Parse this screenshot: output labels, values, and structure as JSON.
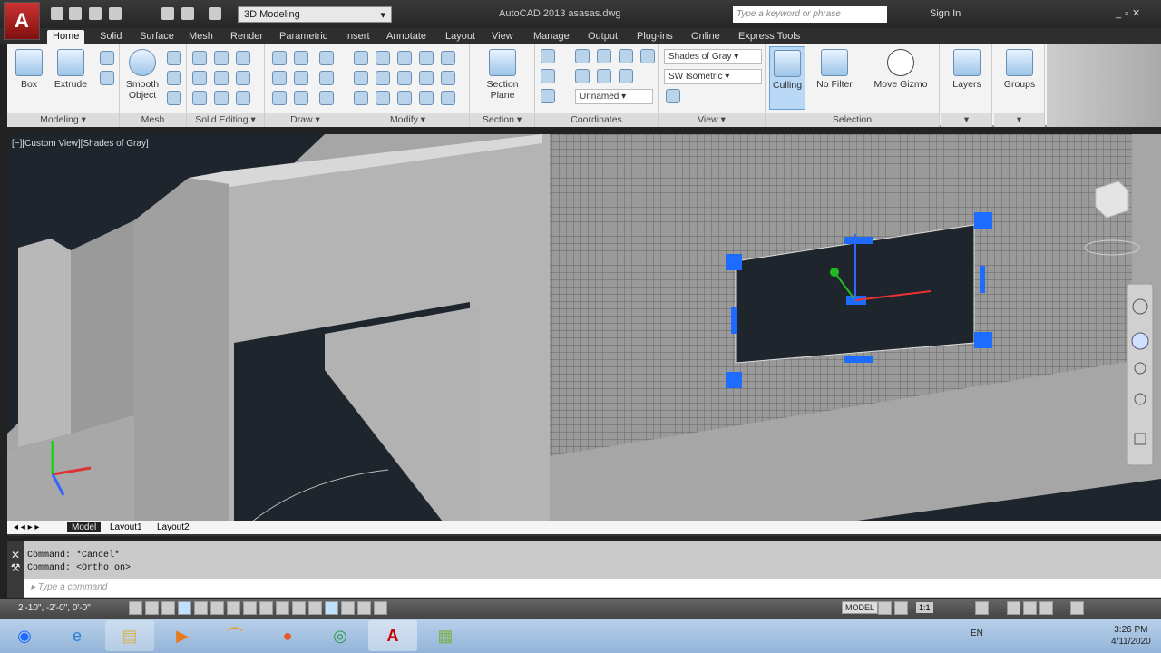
{
  "titlebar": {
    "workspace": "3D Modeling",
    "title": "AutoCAD 2013   asasas.dwg",
    "search_placeholder": "Type a keyword or phrase",
    "signin": "Sign In",
    "app_button": "A"
  },
  "tabs": [
    "Home",
    "Solid",
    "Surface",
    "Mesh",
    "Render",
    "Parametric",
    "Insert",
    "Annotate",
    "Layout",
    "View",
    "Manage",
    "Output",
    "Plug-ins",
    "Online",
    "Express Tools"
  ],
  "ribbon": {
    "modeling": {
      "box": "Box",
      "extrude": "Extrude",
      "label": "Modeling ▾"
    },
    "mesh": {
      "smooth1": "Smooth",
      "smooth2": "Object",
      "label": "Mesh"
    },
    "solid_editing": {
      "label": "Solid Editing ▾"
    },
    "draw": {
      "label": "Draw ▾"
    },
    "modify": {
      "label": "Modify ▾"
    },
    "section": {
      "plane1": "Section",
      "plane2": "Plane",
      "label": "Section ▾"
    },
    "coordinates": {
      "ucs": "Unnamed",
      "label": "Coordinates"
    },
    "view": {
      "visual_style": "Shades of Gray",
      "view_dir": "SW Isometric",
      "label": "View ▾"
    },
    "selection": {
      "culling": "Culling",
      "nofilter": "No Filter",
      "gizmo": "Move Gizmo",
      "label": "Selection"
    },
    "layers": "Layers",
    "groups": "Groups"
  },
  "viewport": {
    "label": "[−][Custom View][Shades of Gray]"
  },
  "layout_tabs": [
    "Model",
    "Layout1",
    "Layout2"
  ],
  "command": {
    "history": [
      "Command: *Cancel*",
      "Command:  <Ortho on>"
    ],
    "placeholder": "Type a command"
  },
  "status": {
    "coords": "2'-10\", -2'-0\", 0'-0\"",
    "model": "MODEL",
    "scale": "1:1"
  },
  "taskbar": {
    "lang": "EN",
    "time": "3:26 PM",
    "date": "4/11/2020"
  },
  "colors": {
    "grip": "#1e6cff",
    "viewport_bg": "#1f252d"
  }
}
